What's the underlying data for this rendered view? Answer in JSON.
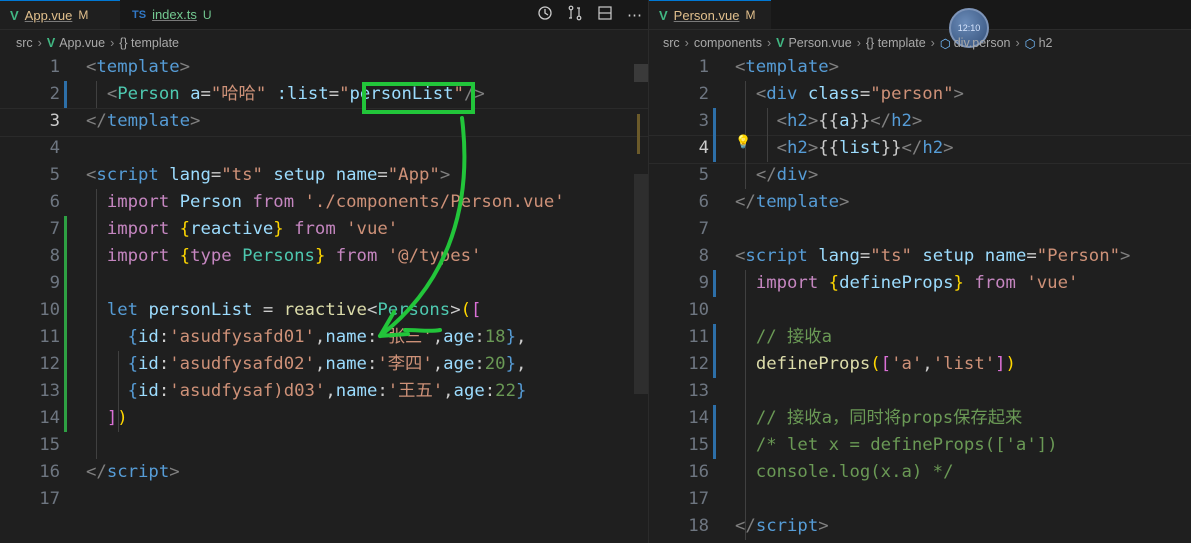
{
  "left": {
    "tabs": [
      {
        "icon": "V",
        "name": "App.vue",
        "badge": "M",
        "active": true
      },
      {
        "icon": "TS",
        "name": "index.ts",
        "badge": "U",
        "active": false
      }
    ],
    "breadcrumb": [
      "src",
      "App.vue",
      "{} template"
    ],
    "lines": [
      {
        "n": "1",
        "html": "<span class='t'>&lt;</span><span class='tg'>template</span><span class='t'>&gt;</span>"
      },
      {
        "n": "2",
        "html": "  <span class='t'>&lt;</span><span class='ty'>Person</span> <span class='at'>a</span><span class='pl'>=</span><span class='st'>\"哈哈\"</span> <span class='at'>:list</span><span class='pl'>=</span><span class='st'>\"</span><span class='vr'>personList</span><span class='st'>\"</span><span class='t'>/&gt;</span>"
      },
      {
        "n": "3",
        "html": "<span class='t'>&lt;/</span><span class='tg'>template</span><span class='t'>&gt;</span>"
      },
      {
        "n": "4",
        "html": ""
      },
      {
        "n": "5",
        "html": "<span class='t'>&lt;</span><span class='tg'>script</span> <span class='at'>lang</span><span class='pl'>=</span><span class='st'>\"ts\"</span> <span class='at'>setup</span> <span class='at'>name</span><span class='pl'>=</span><span class='st'>\"App\"</span><span class='t'>&gt;</span>"
      },
      {
        "n": "6",
        "html": "  <span class='kw'>import</span> <span class='vr'>Person</span> <span class='kw'>from</span> <span class='st'>'./components/Person.vue'</span>"
      },
      {
        "n": "7",
        "html": "  <span class='kw'>import</span> <span class='br'>{</span><span class='vr'>reactive</span><span class='br'>}</span> <span class='kw'>from</span> <span class='st'>'vue'</span>"
      },
      {
        "n": "8",
        "html": "  <span class='kw'>import</span> <span class='br'>{</span><span class='kw'>type</span> <span class='ty'>Persons</span><span class='br'>}</span> <span class='kw'>from</span> <span class='st'>'@/types'</span>"
      },
      {
        "n": "9",
        "html": ""
      },
      {
        "n": "10",
        "html": "  <span class='tg'>let</span> <span class='vr'>personList</span> <span class='pl'>=</span> <span class='fn'>reactive</span><span class='pl'>&lt;</span><span class='ty'>Persons</span><span class='pl'>&gt;</span><span class='br'>(</span><span class='br2'>[</span>"
      },
      {
        "n": "11",
        "html": "    <span class='tg'>{</span><span class='vr'>id</span><span class='pl'>:</span><span class='st'>'asudfysafd01'</span><span class='pl'>,</span><span class='vr'>name</span><span class='pl'>:</span><span class='st'>'张三'</span><span class='pl'>,</span><span class='vr'>age</span><span class='pl'>:</span><span class='cm'>18</span><span class='tg'>}</span><span class='pl'>,</span>"
      },
      {
        "n": "12",
        "html": "    <span class='tg'>{</span><span class='vr'>id</span><span class='pl'>:</span><span class='st'>'asudfysafd02'</span><span class='pl'>,</span><span class='vr'>name</span><span class='pl'>:</span><span class='st'>'李四'</span><span class='pl'>,</span><span class='vr'>age</span><span class='pl'>:</span><span class='cm'>20</span><span class='tg'>}</span><span class='pl'>,</span>"
      },
      {
        "n": "13",
        "html": "    <span class='tg'>{</span><span class='vr'>id</span><span class='pl'>:</span><span class='st'>'asudfysaf)d03'</span><span class='pl'>,</span><span class='vr'>name</span><span class='pl'>:</span><span class='st'>'王五'</span><span class='pl'>,</span><span class='vr'>age</span><span class='pl'>:</span><span class='cm'>22</span><span class='tg'>}</span>"
      },
      {
        "n": "14",
        "html": "  <span class='br2'>]</span><span class='br'>)</span>"
      },
      {
        "n": "15",
        "html": ""
      },
      {
        "n": "16",
        "html": "<span class='t'>&lt;/</span><span class='tg'>script</span><span class='t'>&gt;</span>"
      },
      {
        "n": "17",
        "html": ""
      }
    ]
  },
  "right": {
    "tabs": [
      {
        "icon": "V",
        "name": "Person.vue",
        "badge": "M",
        "active": true
      }
    ],
    "breadcrumb": [
      "src",
      "components",
      "Person.vue",
      "{} template",
      "div.person",
      "h2"
    ],
    "lines": [
      {
        "n": "1",
        "html": "<span class='t'>&lt;</span><span class='tg'>template</span><span class='t'>&gt;</span>"
      },
      {
        "n": "2",
        "html": "  <span class='t'>&lt;</span><span class='tg'>div</span> <span class='at'>class</span><span class='pl'>=</span><span class='st'>\"person\"</span><span class='t'>&gt;</span>"
      },
      {
        "n": "3",
        "html": "    <span class='t'>&lt;</span><span class='tg'>h2</span><span class='t'>&gt;</span><span class='pl'>{{</span><span class='vr'>a</span><span class='pl'>}}</span><span class='t'>&lt;/</span><span class='tg'>h2</span><span class='t'>&gt;</span>"
      },
      {
        "n": "4",
        "html": "    <span class='t'>&lt;</span><span class='tg'>h2</span><span class='t'>&gt;</span><span class='pl'>{{</span><span class='vr'>list</span><span class='pl'>}}</span><span class='t'>&lt;/</span><span class='tg'>h2</span><span class='t'>&gt;</span>"
      },
      {
        "n": "5",
        "html": "  <span class='t'>&lt;/</span><span class='tg'>div</span><span class='t'>&gt;</span>"
      },
      {
        "n": "6",
        "html": "<span class='t'>&lt;/</span><span class='tg'>template</span><span class='t'>&gt;</span>"
      },
      {
        "n": "7",
        "html": ""
      },
      {
        "n": "8",
        "html": "<span class='t'>&lt;</span><span class='tg'>script</span> <span class='at'>lang</span><span class='pl'>=</span><span class='st'>\"ts\"</span> <span class='at'>setup</span> <span class='at'>name</span><span class='pl'>=</span><span class='st'>\"Person\"</span><span class='t'>&gt;</span>"
      },
      {
        "n": "9",
        "html": "  <span class='kw'>import</span> <span class='br'>{</span><span class='vr'>defineProps</span><span class='br'>}</span> <span class='kw'>from</span> <span class='st'>'vue'</span>"
      },
      {
        "n": "10",
        "html": ""
      },
      {
        "n": "11",
        "html": "  <span class='cm'>// 接收a</span>"
      },
      {
        "n": "12",
        "html": "  <span class='fn'>defineProps</span><span class='br'>(</span><span class='br2'>[</span><span class='st'>'a'</span><span class='pl'>,</span><span class='st'>'list'</span><span class='br2'>]</span><span class='br'>)</span>"
      },
      {
        "n": "13",
        "html": ""
      },
      {
        "n": "14",
        "html": "  <span class='cm'>// 接收a，同时将props保存起来</span>"
      },
      {
        "n": "15",
        "html": "  <span class='cm'>/* let x = defineProps(['a'])</span>"
      },
      {
        "n": "16",
        "html": "<span class='cm'>  console.log(x.a) */</span>"
      },
      {
        "n": "17",
        "html": ""
      },
      {
        "n": "18",
        "html": "<span class='t'>&lt;/</span><span class='tg'>script</span><span class='t'>&gt;</span>"
      }
    ]
  },
  "avatar_text": "12:10"
}
